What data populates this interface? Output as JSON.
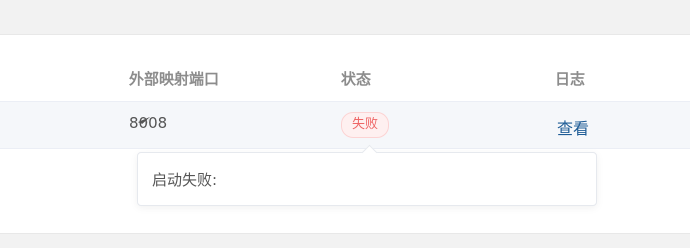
{
  "table": {
    "headers": {
      "port": "外部映射端口",
      "status": "状态",
      "log": "日志"
    },
    "rows": [
      {
        "port": "8008",
        "port_icon": "paper-plane-icon",
        "status": "失败",
        "log_link": "查看"
      }
    ]
  },
  "tooltip": {
    "text": "启动失败:"
  },
  "colors": {
    "status_fail_text": "#ee6666",
    "status_fail_bg": "#fef0f0",
    "link": "#1e5c96",
    "row_highlight": "#f5f7fa"
  }
}
